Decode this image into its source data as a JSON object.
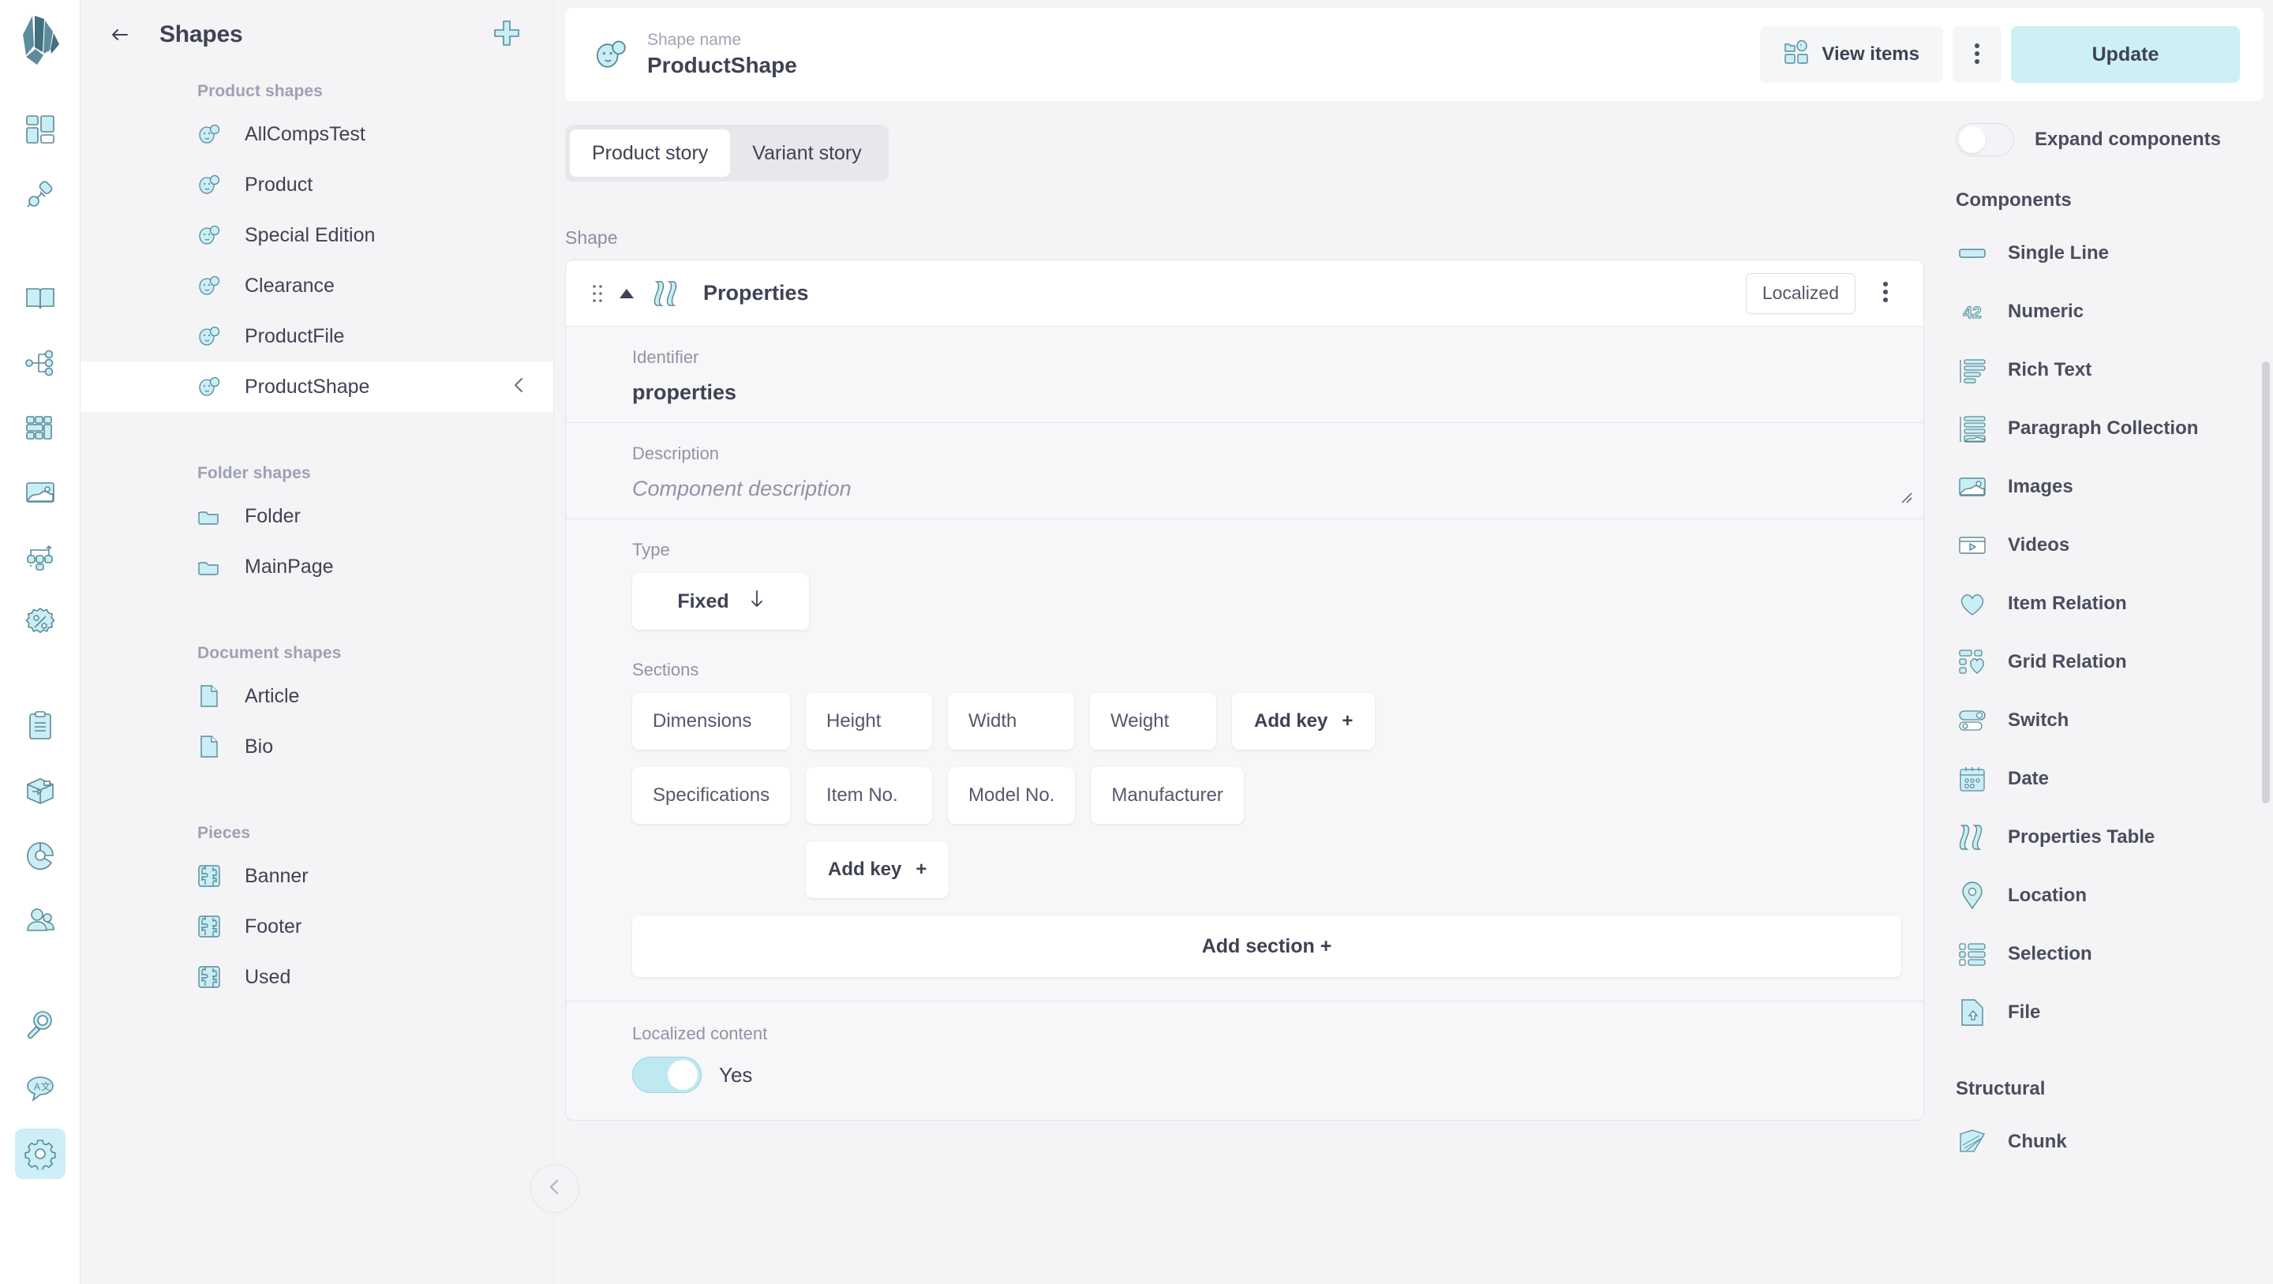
{
  "rail": {
    "logo": "crystallize-logo",
    "items": [
      {
        "icon": "dashboard-icon",
        "name": "dashboard",
        "active": false
      },
      {
        "icon": "plug-icon",
        "name": "integrations",
        "active": false
      },
      {
        "icon": "book-icon",
        "name": "catalogue",
        "active": false
      },
      {
        "icon": "hierarchy-icon",
        "name": "topics",
        "active": false
      },
      {
        "icon": "grid-layout-icon",
        "name": "grids",
        "active": false
      },
      {
        "icon": "image-icon",
        "name": "media",
        "active": false
      },
      {
        "icon": "workflow-icon",
        "name": "workflows",
        "active": false
      },
      {
        "icon": "discount-icon",
        "name": "discounts",
        "active": false
      },
      {
        "icon": "clipboard-icon",
        "name": "orders",
        "active": false
      },
      {
        "icon": "box-icon",
        "name": "shipments",
        "active": false
      },
      {
        "icon": "pie-chart-icon",
        "name": "analytics",
        "active": false
      },
      {
        "icon": "users-icon",
        "name": "customers",
        "active": false
      },
      {
        "icon": "search-icon",
        "name": "search",
        "active": false
      },
      {
        "icon": "translate-icon",
        "name": "translations",
        "active": false
      },
      {
        "icon": "gear-icon",
        "name": "settings",
        "active": true
      }
    ]
  },
  "shapes_panel": {
    "back_icon": "back-arrow-icon",
    "title": "Shapes",
    "add_icon": "plus-icon",
    "collapse_icon": "chevron-left-icon",
    "groups": [
      {
        "label": "Product shapes",
        "icon": "product-shape-icon",
        "items": [
          {
            "name": "AllCompsTest",
            "selected": false
          },
          {
            "name": "Product",
            "selected": false
          },
          {
            "name": "Special Edition",
            "selected": false
          },
          {
            "name": "Clearance",
            "selected": false
          },
          {
            "name": "ProductFile",
            "selected": false
          },
          {
            "name": "ProductShape",
            "selected": true
          }
        ]
      },
      {
        "label": "Folder shapes",
        "icon": "folder-shape-icon",
        "items": [
          {
            "name": "Folder",
            "selected": false
          },
          {
            "name": "MainPage",
            "selected": false
          }
        ]
      },
      {
        "label": "Document shapes",
        "icon": "document-shape-icon",
        "items": [
          {
            "name": "Article",
            "selected": false
          },
          {
            "name": "Bio",
            "selected": false
          }
        ]
      },
      {
        "label": "Pieces",
        "icon": "piece-shape-icon",
        "items": [
          {
            "name": "Banner",
            "selected": false
          },
          {
            "name": "Footer",
            "selected": false
          },
          {
            "name": "Used",
            "selected": false
          }
        ]
      }
    ]
  },
  "topbar": {
    "shape_icon": "product-shape-icon",
    "name_label": "Shape name",
    "name_value": "ProductShape",
    "view_items_label": "View items",
    "view_items_icon": "items-grid-icon",
    "kebab_icon": "kebab-menu-icon",
    "update_label": "Update"
  },
  "tabs": [
    {
      "label": "Product story",
      "active": true
    },
    {
      "label": "Variant story",
      "active": false
    }
  ],
  "shape_section": {
    "label": "Shape",
    "component": {
      "drag_icon": "drag-handle-icon",
      "collapse_icon": "caret-up-icon",
      "type_icon": "properties-table-icon",
      "title": "Properties",
      "badge": "Localized",
      "kebab_icon": "kebab-menu-icon",
      "identifier_label": "Identifier",
      "identifier_value": "properties",
      "description_label": "Description",
      "description_placeholder": "Component description",
      "type_label": "Type",
      "type_value": "Fixed",
      "type_dropdown_icon": "arrow-down-icon",
      "sections_label": "Sections",
      "sections": [
        {
          "name": "Dimensions",
          "keys": [
            "Height",
            "Width",
            "Weight"
          ],
          "add_key_label": "Add key",
          "add_key_inline": true
        },
        {
          "name": "Specifications",
          "keys": [
            "Item No.",
            "Model No.",
            "Manufacturer"
          ],
          "add_key_label": "Add key",
          "add_key_inline": false
        }
      ],
      "add_section_label": "Add section +",
      "localized_content_label": "Localized content",
      "localized_content_value": "Yes",
      "localized_content_on": true
    }
  },
  "right_pane": {
    "expand_toggle_label": "Expand components",
    "expand_toggle_on": false,
    "components_label": "Components",
    "components": [
      {
        "label": "Single Line",
        "icon": "single-line-icon"
      },
      {
        "label": "Numeric",
        "icon": "numeric-icon"
      },
      {
        "label": "Rich Text",
        "icon": "rich-text-icon"
      },
      {
        "label": "Paragraph Collection",
        "icon": "paragraph-collection-icon"
      },
      {
        "label": "Images",
        "icon": "images-icon"
      },
      {
        "label": "Videos",
        "icon": "videos-icon"
      },
      {
        "label": "Item Relation",
        "icon": "item-relation-icon"
      },
      {
        "label": "Grid Relation",
        "icon": "grid-relation-icon"
      },
      {
        "label": "Switch",
        "icon": "switch-icon"
      },
      {
        "label": "Date",
        "icon": "date-icon"
      },
      {
        "label": "Properties Table",
        "icon": "properties-table-icon"
      },
      {
        "label": "Location",
        "icon": "location-icon"
      },
      {
        "label": "Selection",
        "icon": "selection-icon"
      },
      {
        "label": "File",
        "icon": "file-icon"
      }
    ],
    "structural_label": "Structural",
    "structural": [
      {
        "label": "Chunk",
        "icon": "chunk-icon"
      }
    ]
  },
  "colors": {
    "accent": "#cdf0f5",
    "icon_fill": "#c9eef5",
    "icon_stroke": "#5a8a97",
    "text": "#3f4254",
    "muted": "#9093a6",
    "page_bg": "#f4f4f6"
  }
}
